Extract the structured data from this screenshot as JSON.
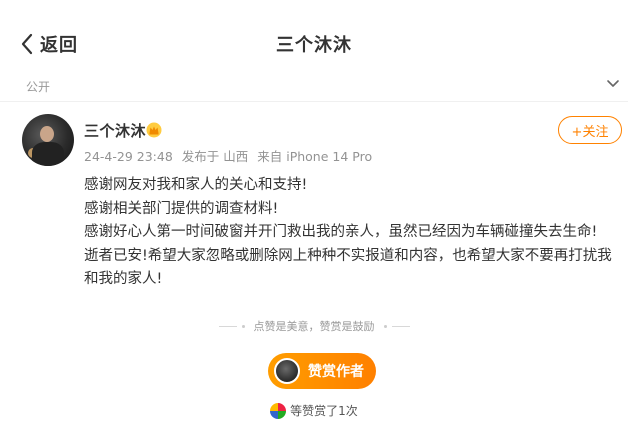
{
  "nav": {
    "back_label": "返回",
    "title": "三个沐沐"
  },
  "privacy": {
    "label": "公开"
  },
  "post": {
    "author": "三个沐沐",
    "date": "24-4-29 23:48",
    "published_from": "发布于 山西",
    "device": "来自 iPhone 14 Pro",
    "follow_label": "+关注",
    "paragraphs": [
      "感谢网友对我和家人的关心和支持!",
      "感谢相关部门提供的调查材料!",
      "感谢好心人第一时间破窗并开门救出我的亲人，虽然已经因为车辆碰撞失去生命!",
      "逝者已安!希望大家忽略或删除网上种种不实报道和内容，也希望大家不要再打扰我和我的家人!"
    ]
  },
  "reward": {
    "divider_text": "点赞是美意，赞赏是鼓励",
    "button_label": "赞赏作者",
    "count_text": "等赞赏了1次"
  },
  "colors": {
    "accent": "#ff8200",
    "meta_text": "#939393"
  },
  "icons": {
    "back": "chevron-left-icon",
    "privacy": "chevron-down-icon",
    "badge": "crown-badge-icon"
  }
}
